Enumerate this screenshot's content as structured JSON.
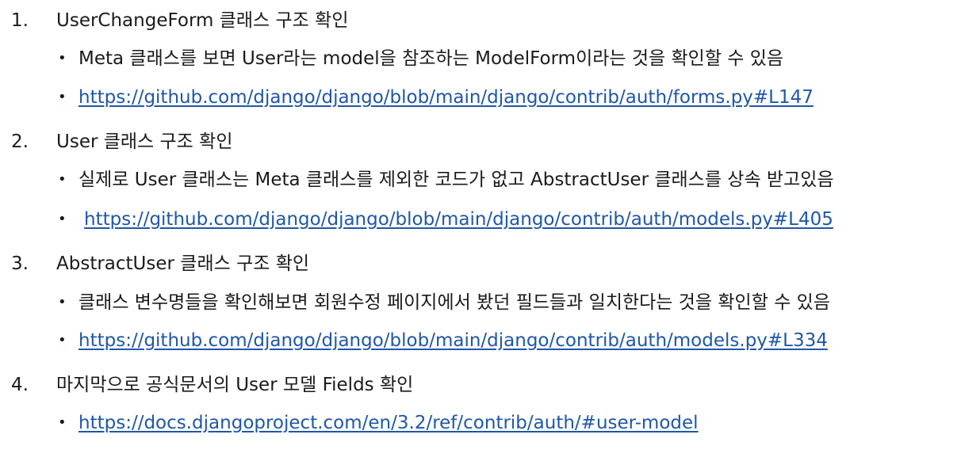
{
  "sections": [
    {
      "number": "1.",
      "title": "UserChangeForm 클래스 구조 확인",
      "bullets": [
        {
          "text": "Meta 클래스를 보면 User라는 model을 참조하는 ModelForm이라는 것을 확인할 수 있음"
        },
        {
          "text": "https://github.com/django/django/blob/main/django/contrib/auth/forms.py#L147"
        }
      ]
    },
    {
      "number": "2.",
      "title": "User 클래스 구조 확인",
      "bullets": [
        {
          "text": "실제로 User 클래스는 Meta 클래스를 제외한 코드가 없고 AbstractUser 클래스를 상속 받고있음"
        },
        {
          "text": "https://github.com/django/django/blob/main/django/contrib/auth/models.py#L405"
        }
      ]
    },
    {
      "number": "3.",
      "title": "AbstractUser 클래스 구조 확인",
      "bullets": [
        {
          "text": "클래스 변수명들을 확인해보면 회원수정 페이지에서 봤던 필드들과 일치한다는 것을 확인할 수 있음"
        },
        {
          "text": "https://github.com/django/django/blob/main/django/contrib/auth/models.py#L334"
        }
      ]
    },
    {
      "number": "4.",
      "title": "마지막으로 공식문서의 User 모델 Fields 확인",
      "bullets": [
        {
          "text": "https://docs.djangoproject.com/en/3.2/ref/contrib/auth/#user-model"
        }
      ]
    }
  ],
  "bullet_glyph": "•"
}
